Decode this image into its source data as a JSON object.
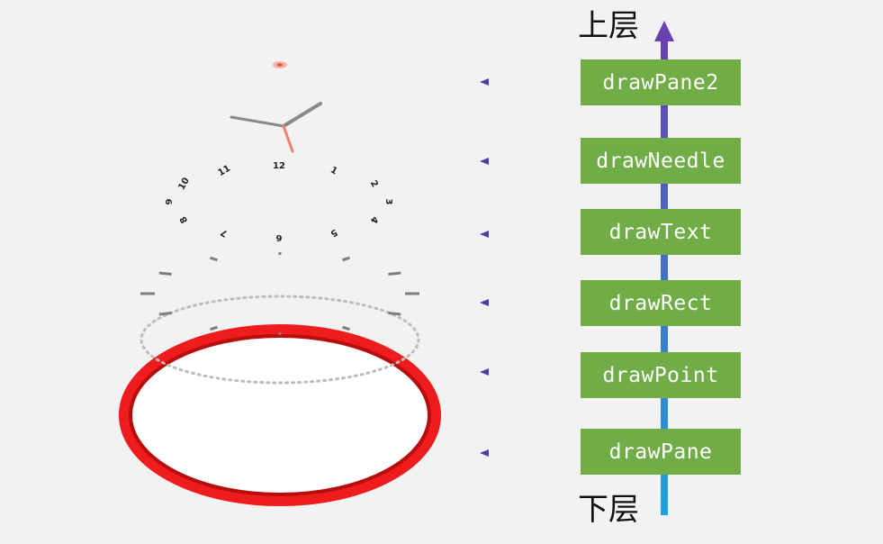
{
  "axis": {
    "top_label": "上层",
    "bottom_label": "下层"
  },
  "layers": [
    {
      "label": "drawPane2"
    },
    {
      "label": "drawNeedle"
    },
    {
      "label": "drawText"
    },
    {
      "label": "drawRect"
    },
    {
      "label": "drawPoint"
    },
    {
      "label": "drawPane"
    }
  ],
  "clock": {
    "numbers": [
      "1",
      "2",
      "3",
      "4",
      "5",
      "6",
      "7",
      "8",
      "9",
      "10",
      "11",
      "12"
    ]
  },
  "colors": {
    "layer_box": "#70ad47",
    "axis_top": "#6a3fb0",
    "axis_bottom": "#1ba4e0",
    "arrow_start": "#1ba4e0",
    "arrow_end": "#4b3fa5",
    "pane_ring": "#ee1c1c",
    "needle_second": "#f08070",
    "needle_hand": "#8a8a8a"
  }
}
